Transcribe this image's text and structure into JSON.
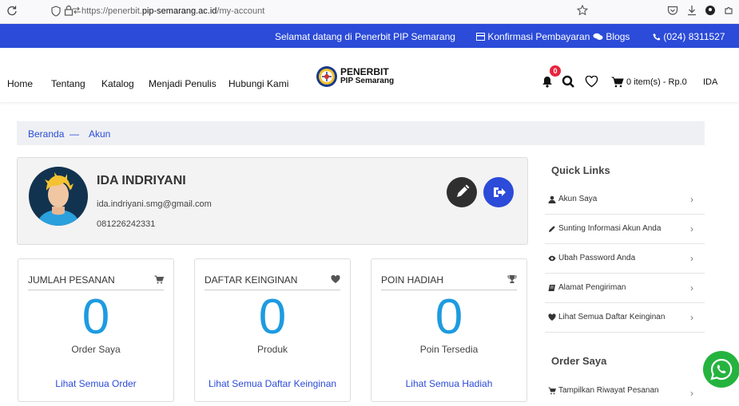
{
  "browser": {
    "url_prefix": "https://penerbit.",
    "url_domain": "pip-semarang.ac.id",
    "url_path": "/my-account"
  },
  "topbar": {
    "welcome": "Selamat datang di Penerbit PIP Semarang",
    "confirm": "Konfirmasi Pembayaran",
    "blogs": "Blogs",
    "phone": "(024) 8311527"
  },
  "nav": {
    "items": [
      "Home",
      "Tentang",
      "Katalog",
      "Menjadi Penulis",
      "Hubungi Kami"
    ],
    "logo_line1": "PENERBIT",
    "logo_line2": "PIP Semarang",
    "notif_count": "0",
    "cart": "0 item(s) - Rp.0",
    "user": "IDA"
  },
  "breadcrumb": {
    "home": "Beranda",
    "sep": "—",
    "current": "Akun"
  },
  "profile": {
    "name": "IDA INDRIYANI",
    "email": "ida.indriyani.smg@gmail.com",
    "phone": "081226242331"
  },
  "stats": [
    {
      "title": "JUMLAH PESANAN",
      "value": "0",
      "sub": "Order Saya",
      "link": "Lihat Semua Order",
      "icon": "cart-icon"
    },
    {
      "title": "DAFTAR KEINGINAN",
      "value": "0",
      "sub": "Produk",
      "link": "Lihat Semua Daftar Keinginan",
      "icon": "heart-icon"
    },
    {
      "title": "POIN HADIAH",
      "value": "0",
      "sub": "Poin Tersedia",
      "link": "Lihat Semua Hadiah",
      "icon": "trophy-icon"
    }
  ],
  "sidebar": {
    "quick_links_title": "Quick Links",
    "quick_links": [
      {
        "label": "Akun Saya",
        "icon": "user-icon"
      },
      {
        "label": "Sunting Informasi Akun Anda",
        "icon": "pencil-icon"
      },
      {
        "label": "Ubah Password Anda",
        "icon": "eye-icon"
      },
      {
        "label": "Alamat Pengiriman",
        "icon": "book-icon"
      },
      {
        "label": "Lihat Semua Daftar Keinginan",
        "icon": "heart-icon"
      }
    ],
    "order_title": "Order Saya",
    "order_links": [
      {
        "label": "Tampilkan Riwayat Pesanan",
        "icon": "cart-icon"
      }
    ]
  },
  "colors": {
    "brand_blue": "#2b4bd8",
    "accent_cyan": "#1e9be0",
    "whatsapp_green": "#25b33f"
  }
}
